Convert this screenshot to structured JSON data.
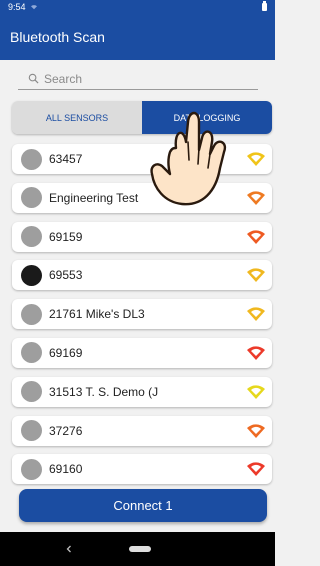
{
  "status": {
    "time": "9:54"
  },
  "app": {
    "title": "Bluetooth Scan"
  },
  "search": {
    "placeholder": "Search"
  },
  "tabs": [
    {
      "label": "ALL SENSORS",
      "selected": false
    },
    {
      "label": "DATA LOGGING",
      "selected": true
    }
  ],
  "devices": [
    {
      "name": "63457",
      "dot_color": "#9e9e9e",
      "signal_color": "#f0c419"
    },
    {
      "name": "Engineering Test",
      "dot_color": "#9e9e9e",
      "signal_color": "#ee7a22"
    },
    {
      "name": "69159",
      "dot_color": "#9e9e9e",
      "signal_color": "#ee5a22"
    },
    {
      "name": "69553",
      "dot_color": "#1a1a1a",
      "signal_color": "#f0b81f"
    },
    {
      "name": "21761 Mike's DL3",
      "dot_color": "#9e9e9e",
      "signal_color": "#f0b81f"
    },
    {
      "name": "69169",
      "dot_color": "#9e9e9e",
      "signal_color": "#ec3a2a"
    },
    {
      "name": "31513 T. S. Demo (J",
      "dot_color": "#9e9e9e",
      "signal_color": "#e6d81c"
    },
    {
      "name": "37276",
      "dot_color": "#9e9e9e",
      "signal_color": "#ee6a22"
    },
    {
      "name": "69160",
      "dot_color": "#9e9e9e",
      "signal_color": "#ec3a2a"
    }
  ],
  "connect_label": "Connect 1",
  "colors": {
    "primary": "#1b4da2",
    "background": "#f1f1f1"
  }
}
